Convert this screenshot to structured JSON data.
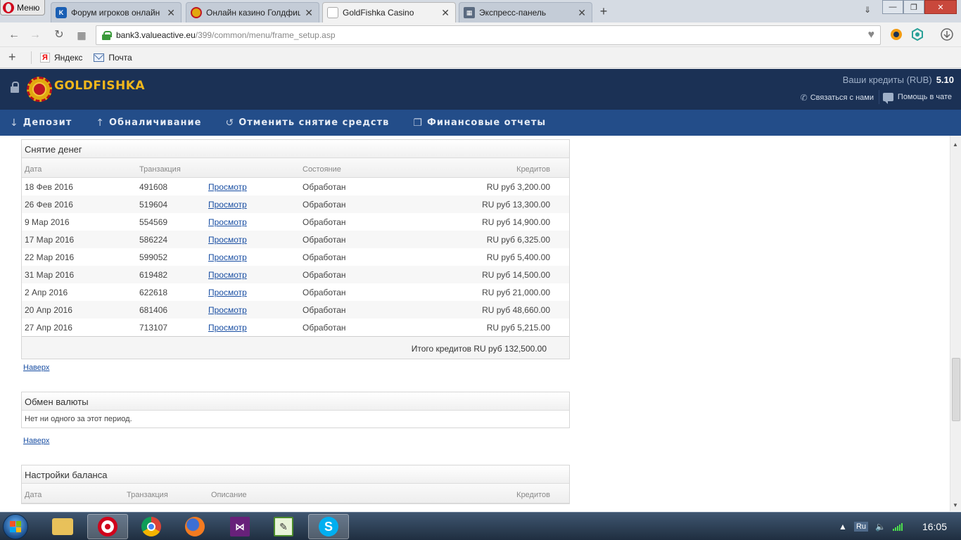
{
  "browser": {
    "menu_label": "Меню",
    "tabs": [
      {
        "label": "Форум игроков онлайн каз",
        "active": false
      },
      {
        "label": "Онлайн казино Голдфишка",
        "active": false
      },
      {
        "label": "GoldFishka Casino",
        "active": true
      },
      {
        "label": "Экспресс-панель",
        "active": false
      }
    ],
    "url_host": "bank3.valueactive.eu",
    "url_path": "/399/common/menu/frame_setup.asp",
    "bookmarks": [
      {
        "label": "Яндекс",
        "icon": "yandex-icon"
      },
      {
        "label": "Почта",
        "icon": "mail-icon"
      }
    ]
  },
  "casino": {
    "logo_text": "GOLDFISHKA",
    "credits_label": "Ваши кредиты (RUB)",
    "credits_value": "5.10",
    "contact_label": "Связаться с нами",
    "chat_label": "Помощь в чате",
    "nav": [
      {
        "label": "Депозит",
        "icon": "arrow-down-icon"
      },
      {
        "label": "Обналичивание",
        "icon": "arrow-up-icon"
      },
      {
        "label": "Отменить снятие средств",
        "icon": "undo-icon"
      },
      {
        "label": "Финансовые отчеты",
        "icon": "copy-icon"
      }
    ]
  },
  "withdrawals": {
    "title": "Снятие денег",
    "columns": {
      "date": "Дата",
      "transaction": "Транзакция",
      "status": "Состояние",
      "credits": "Кредитов"
    },
    "rows": [
      {
        "date": "18 Фев 2016",
        "transaction": "491608",
        "link": "Просмотр",
        "status": "Обработан",
        "credits": "RU руб 3,200.00"
      },
      {
        "date": "26 Фев 2016",
        "transaction": "519604",
        "link": "Просмотр",
        "status": "Обработан",
        "credits": "RU руб 13,300.00"
      },
      {
        "date": "9 Мар 2016",
        "transaction": "554569",
        "link": "Просмотр",
        "status": "Обработан",
        "credits": "RU руб 14,900.00"
      },
      {
        "date": "17 Мар 2016",
        "transaction": "586224",
        "link": "Просмотр",
        "status": "Обработан",
        "credits": "RU руб 6,325.00"
      },
      {
        "date": "22 Мар 2016",
        "transaction": "599052",
        "link": "Просмотр",
        "status": "Обработан",
        "credits": "RU руб 5,400.00"
      },
      {
        "date": "31 Мар 2016",
        "transaction": "619482",
        "link": "Просмотр",
        "status": "Обработан",
        "credits": "RU руб 14,500.00"
      },
      {
        "date": "2 Апр 2016",
        "transaction": "622618",
        "link": "Просмотр",
        "status": "Обработан",
        "credits": "RU руб 21,000.00"
      },
      {
        "date": "20 Апр 2016",
        "transaction": "681406",
        "link": "Просмотр",
        "status": "Обработан",
        "credits": "RU руб 48,660.00"
      },
      {
        "date": "27 Апр 2016",
        "transaction": "713107",
        "link": "Просмотр",
        "status": "Обработан",
        "credits": "RU руб 5,215.00"
      }
    ],
    "total_label": "Итого кредитов",
    "total_value": "RU руб 132,500.00"
  },
  "top_link": "Наверх",
  "exchange": {
    "title": "Обмен валюты",
    "empty_text": "Нет ни одного за этот период."
  },
  "balance": {
    "title": "Настройки баланса",
    "columns": {
      "date": "Дата",
      "transaction": "Транзакция",
      "description": "Описание",
      "credits": "Кредитов"
    }
  },
  "taskbar": {
    "language": "Ru",
    "time": "16:05",
    "apps": [
      "explorer",
      "opera",
      "chrome",
      "firefox",
      "visual-studio",
      "notepad",
      "skype"
    ]
  }
}
